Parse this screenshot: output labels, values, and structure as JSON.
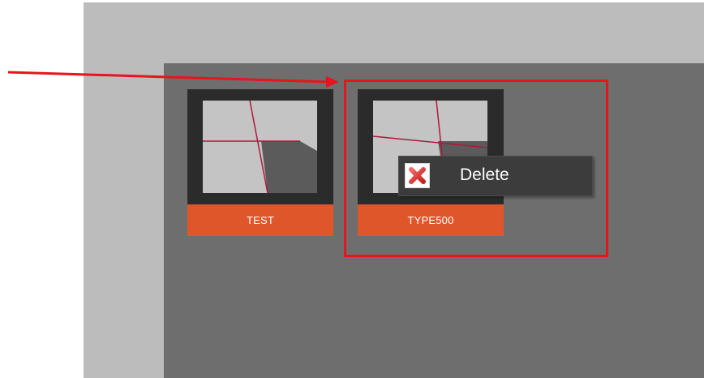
{
  "colors": {
    "outer_frame": "#bcbcbc",
    "inner_panel": "#6e6e6e",
    "tile_frame": "#2b2b2b",
    "tile_label_bg": "#e0562b",
    "annotation_red": "#e8141c",
    "menu_bg": "#3c3c3c"
  },
  "items": [
    {
      "label": "TEST"
    },
    {
      "label": "TYPE500"
    }
  ],
  "context_menu": {
    "items": [
      {
        "label": "Delete",
        "icon": "red-x-icon"
      }
    ]
  },
  "annotations": {
    "arrow_icon": "red-arrow-icon",
    "highlight": "red-highlight-box"
  }
}
